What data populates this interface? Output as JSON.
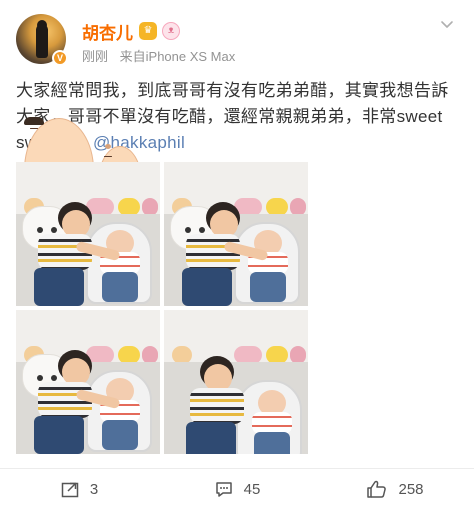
{
  "post": {
    "author": {
      "name": "胡杏儿",
      "verified_icon": "orange-verified-icon",
      "level_badge_icon": "gold-member-icon",
      "pig_badge_icon": "pink-pig-badge-icon"
    },
    "meta": {
      "time": "刚刚",
      "source": "来自iPhone XS Max"
    },
    "text": {
      "body": "大家經常問我，到底哥哥有沒有吃弟弟醋，其實我想告訴大家，哥哥不單沒有吃醋，還經常親親弟弟，非常sweet sweet ",
      "emoji_icons": [
        "question-box-icon",
        "boy-face-emoji-icon",
        "baby-face-emoji-icon"
      ],
      "mention": "@hakkaphil"
    },
    "photos": [
      {
        "alt_icon": "photo-kids-1"
      },
      {
        "alt_icon": "photo-kids-2"
      },
      {
        "alt_icon": "photo-kids-3"
      },
      {
        "alt_icon": "photo-kids-4"
      }
    ],
    "actions": {
      "repost_count": "3",
      "comment_count": "45",
      "like_count": "258"
    }
  },
  "colors": {
    "name": "#f86d00",
    "mention": "#5b7fb3",
    "meta": "#939393"
  }
}
